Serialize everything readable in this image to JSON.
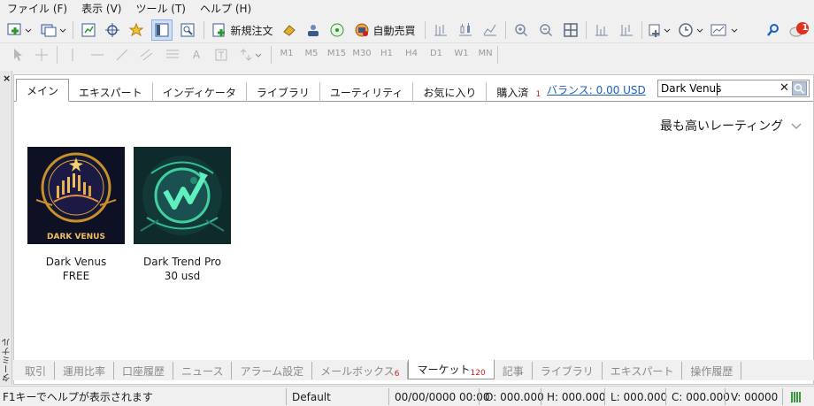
{
  "menu": [
    "ファイル (F)",
    "表示 (V)",
    "ツール (T)",
    "ヘルプ (H)"
  ],
  "toolbar": {
    "new_order_label": "新規注文",
    "auto_trade_label": "自動売買",
    "notification_count": "1",
    "timeframes": [
      "M1",
      "M5",
      "M15",
      "M30",
      "H1",
      "H4",
      "D1",
      "W1",
      "MN"
    ]
  },
  "sidebar": {
    "close_label": "×",
    "vertical_label": "ターミナル"
  },
  "market": {
    "tabs": [
      "メイン",
      "エキスパート",
      "インディケータ",
      "ライブラリ",
      "ユーティリティ",
      "お気に入り",
      "購入済"
    ],
    "purchased_count": "1",
    "balance_label": "バランス: 0.00 USD",
    "search_value": "Dark Venus",
    "sort_label": "最も高いレーティング",
    "products": [
      {
        "name": "Dark Venus",
        "price": "FREE",
        "logo_text": "DARK VENUS"
      },
      {
        "name": "Dark Trend Pro",
        "price": "30 usd"
      }
    ]
  },
  "bottom_tabs": [
    "取引",
    "運用比率",
    "口座履歴",
    "ニュース",
    "アラーム設定",
    "メールボックス",
    "マーケット",
    "記事",
    "ライブラリ",
    "エキスパート",
    "操作履歴"
  ],
  "bottom_badges": {
    "mailbox": "6",
    "market": "120"
  },
  "status": {
    "help": "F1キーでヘルプが表示されます",
    "profile": "Default",
    "datetime": "00/00/0000 00:00",
    "open": "O: 000.000",
    "high": "H: 000.000",
    "low": "L: 000.000",
    "close": "C: 000.000",
    "volume": "V: 00000"
  },
  "colors": {
    "link": "#1f5fbf",
    "badge": "#d02020",
    "accent": "#3a5a8a"
  }
}
